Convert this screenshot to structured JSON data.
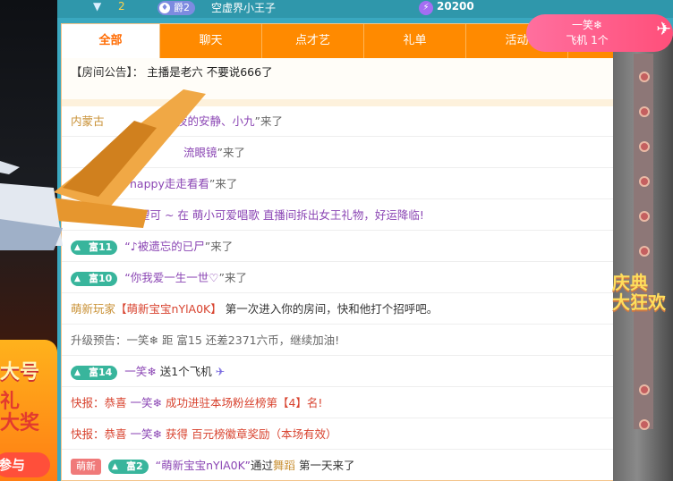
{
  "left_promo": {
    "line1": "大号",
    "line2": "礼\n大奖",
    "button": "参与"
  },
  "topbar": {
    "rank": "2",
    "badge_label": "爵2",
    "username": "空虚界小王子",
    "coins": "20200"
  },
  "gift_pill": {
    "user": "一笑❄",
    "gift": "飞机 1个"
  },
  "tabs": [
    "全部",
    "聊天",
    "点才艺",
    "礼单",
    "活动"
  ],
  "notice": {
    "label": "【房间公告】：",
    "text": "主播是老六 不要说666了"
  },
  "messages": {
    "m1": {
      "prefix": "内蒙古",
      "user": "深夜的安静、小九",
      "suffix": "”来了"
    },
    "m2": {
      "user": "流眼镜",
      "suffix": "”来了"
    },
    "m3": {
      "user": "happy走走看看",
      "suffix": "”来了"
    },
    "m4": {
      "text": "望可 ~ 在 萌小可爱唱歌 直播间拆出女王礼物，好运降临!"
    },
    "m5": {
      "badge": "富11",
      "user": "“♪被遗忘的已尸",
      "suffix": "”来了"
    },
    "m6": {
      "badge": "富10",
      "user": "“你我爱一生一世♡",
      "suffix": "”来了"
    },
    "m7": {
      "prefix": "萌新玩家",
      "user": "【萌新宝宝nYlA0K】",
      "text": "第一次进入你的房间，快和他打个招呼吧。"
    },
    "m8": {
      "text": "升级预告：一笑❄ 距 富15 还差2371六币，继续加油!"
    },
    "m9": {
      "badge": "富14",
      "user": "一笑❄",
      "text": "送1个飞机"
    },
    "m10": {
      "prefix": "快报：恭喜",
      "user": "一笑❄",
      "text": "成功进驻本场粉丝榜第【4】名!"
    },
    "m11": {
      "prefix": "快报：恭喜",
      "user": "一笑❄",
      "text": "获得 百元榜徽章奖励（本场有效）"
    },
    "m12": {
      "tag": "萌新",
      "badge": "富2",
      "user": "“萌新宝宝nYlA0K”",
      "mid": "通过",
      "dance": "舞蹈",
      "suffix": "第一天来了"
    }
  },
  "right_banner": "庆典\n大狂欢",
  "colors": {
    "tab_bg": "#ff8a00",
    "accent": "#ff6a00",
    "rich_badge": "#38b59c",
    "user_purple": "#8b46b4",
    "alert_red": "#d8432f"
  },
  "icons": [
    "chevron-down-icon",
    "title-badge-icon",
    "coin-icon",
    "airplane-icon",
    "rich-level-icon"
  ]
}
